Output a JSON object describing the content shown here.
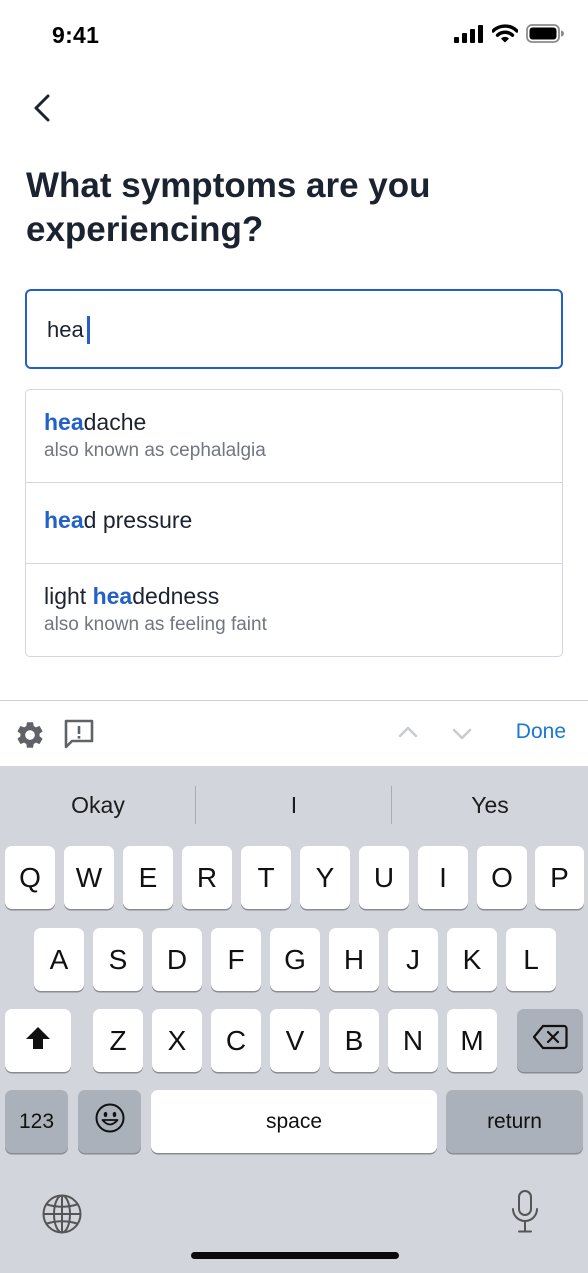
{
  "status_bar": {
    "time": "9:41",
    "icons": [
      "cellular-signal-icon",
      "wifi-icon",
      "battery-icon"
    ]
  },
  "header": {
    "back_icon": "chevron-left-icon",
    "title": "What symptoms are you experiencing?"
  },
  "search": {
    "value": "hea"
  },
  "suggestions": [
    {
      "prefix": "",
      "highlight": "hea",
      "suffix": "dache",
      "alias": "also known as cephalalgia"
    },
    {
      "prefix": "",
      "highlight": "hea",
      "suffix": "d pressure",
      "alias": ""
    },
    {
      "prefix": "light ",
      "highlight": "hea",
      "suffix": "dedness",
      "alias": "also known as feeling faint"
    }
  ],
  "accessory_bar": {
    "icons": [
      "gear-icon",
      "feedback-icon",
      "chevron-up-icon",
      "chevron-down-icon"
    ],
    "done_label": "Done"
  },
  "keyboard": {
    "predictions": [
      "Okay",
      "I",
      "Yes"
    ],
    "row1": [
      "Q",
      "W",
      "E",
      "R",
      "T",
      "Y",
      "U",
      "I",
      "O",
      "P"
    ],
    "row2": [
      "A",
      "S",
      "D",
      "F",
      "G",
      "H",
      "J",
      "K",
      "L"
    ],
    "row3": [
      "Z",
      "X",
      "C",
      "V",
      "B",
      "N",
      "M"
    ],
    "numbers_label": "123",
    "space_label": "space",
    "return_label": "return",
    "icons": [
      "shift-icon",
      "backspace-icon",
      "emoji-icon",
      "globe-icon",
      "microphone-icon"
    ]
  },
  "colors": {
    "accent": "#2460c8",
    "done": "#1a78d2",
    "keyboard_bg": "#d2d5db"
  }
}
